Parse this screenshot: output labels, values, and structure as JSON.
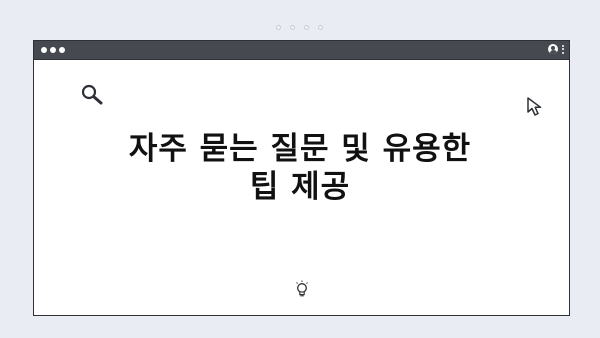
{
  "page": {
    "heading_line1": "자주 묻는 질문 및 유용한",
    "heading_line2": "팁 제공"
  },
  "icons": {
    "search": "search-icon",
    "cursor": "cursor-arrow-icon",
    "bulb": "lightbulb-icon",
    "user": "user-icon",
    "menu": "kebab-menu-icon"
  },
  "colors": {
    "background": "#e9ecf2",
    "titlebar": "#46494f",
    "window": "#ffffff",
    "text": "#111111"
  }
}
